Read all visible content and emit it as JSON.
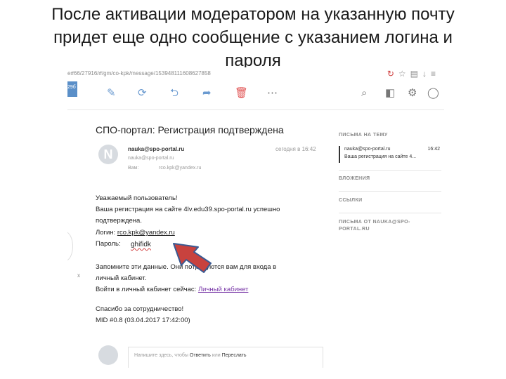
{
  "slide": {
    "title_line1": "После активации модератором на указанную почту",
    "title_line2": "придет еще одно сообщение с указанием логина и",
    "title_line3": "пароля"
  },
  "browser": {
    "url": "e#66/27916/#/gm/co-kpk/message/153948111608627858",
    "reload_icon": "reload-icon"
  },
  "toolbar": {
    "left_badge": "29б",
    "icons": [
      "compose-icon",
      "refresh-icon",
      "reply-icon",
      "forward-icon",
      "delete-icon",
      "more-icon",
      "search-icon",
      "contacts-icon",
      "settings-icon",
      "profile-icon"
    ]
  },
  "message": {
    "subject": "СПО-портал: Регистрация подтверждена",
    "avatar_letter": "N",
    "from": "nauka@spo-portal.ru",
    "date": "сегодня в 16:42",
    "to": "nauka@spo-portal.ru",
    "cc_label": "Вам:",
    "cc": "rco.kpk@yandex.ru",
    "greeting": "Уважаемый пользователь!",
    "line1": "Ваша регистрация на сайте 4lv.edu39.spo-portal.ru успешно",
    "line2": "подтверждена.",
    "login_label": "Логин:",
    "login_value": "rco.kpk@yandex.ru",
    "password_label": "Пароль:",
    "password_value": "ghifidk",
    "remember1": "Запомните эти данные. Они потребуются вам для входа в",
    "remember2": "личный кабинет.",
    "enter_prefix": "Войти в личный кабинет сейчас:",
    "enter_link": "Личный кабинет",
    "thanks": "Спасибо за сотрудничество!",
    "mid": "MID #0.8 (03.04.2017 17:42:00)",
    "reply_placeholder": "Напишите здесь, чтобы",
    "reply_action": "Ответить",
    "reply_or": "или",
    "forward_action": "Переслать"
  },
  "sidebar": {
    "thread_heading": "ПИСЬМА НА ТЕМУ",
    "related_from": "nauka@spo-portal.ru",
    "related_time": "16:42",
    "related_subject": "Ваша регистрация на сайте 4...",
    "attachments_heading": "ВЛОЖЕНИЯ",
    "links_heading": "ССЫЛКИ",
    "from_heading1": "ПИСЬМА ОТ NAUKA@SPO-",
    "from_heading2": "PORTAL.RU"
  },
  "colors": {
    "arrow_fill": "#c8423e",
    "arrow_stroke": "#3a5a92",
    "link": "#7a3aa8",
    "accent": "#6a9ad0"
  }
}
